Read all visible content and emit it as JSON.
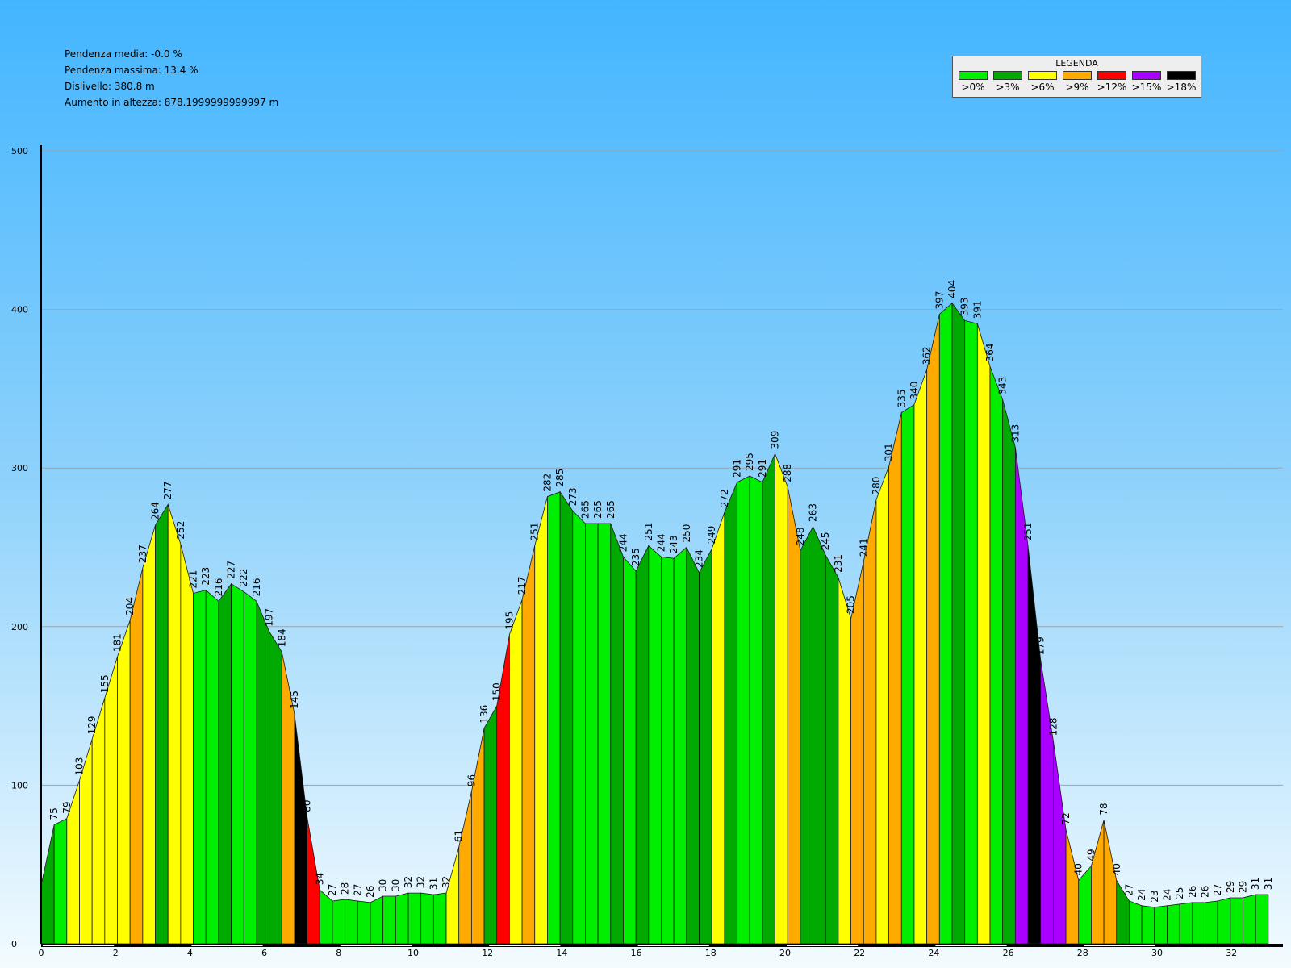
{
  "stats": {
    "avg_slope": "Pendenza media: -0.0 %",
    "max_slope": "Pendenza massima: 13.4 %",
    "drop": "Dislivello: 380.8 m",
    "gain": "Aumento in altezza: 878.1999999999997 m"
  },
  "legend": {
    "title": "LEGENDA",
    "items": [
      {
        "label": ">0%",
        "color": "#00ee00"
      },
      {
        "label": ">3%",
        "color": "#00aa00"
      },
      {
        "label": ">6%",
        "color": "#ffff00"
      },
      {
        "label": ">9%",
        "color": "#ffaa00"
      },
      {
        "label": ">12%",
        "color": "#ff0000"
      },
      {
        "label": ">15%",
        "color": "#aa00ff"
      },
      {
        "label": ">18%",
        "color": "#000000"
      }
    ]
  },
  "chart_data": {
    "type": "area",
    "ylim": [
      0,
      500
    ],
    "xlim": [
      0,
      33.5
    ],
    "yticks": [
      0,
      100,
      200,
      300,
      400,
      500
    ],
    "xticks": [
      0,
      2,
      4,
      6,
      8,
      10,
      12,
      14,
      16,
      18,
      20,
      22,
      24,
      26,
      28,
      30,
      32
    ],
    "grid": true,
    "legend_position": "top-right",
    "start_elevation": 37,
    "points": [
      [
        0.35,
        75,
        ">3%"
      ],
      [
        0.69,
        79,
        ">0%"
      ],
      [
        1.03,
        103,
        ">6%"
      ],
      [
        1.37,
        129,
        ">6%"
      ],
      [
        1.71,
        155,
        ">6%"
      ],
      [
        2.05,
        181,
        ">6%"
      ],
      [
        2.39,
        204,
        ">6%"
      ],
      [
        2.73,
        237,
        ">9%"
      ],
      [
        3.07,
        264,
        ">6%"
      ],
      [
        3.41,
        277,
        ">3%"
      ],
      [
        3.75,
        252,
        ">6%"
      ],
      [
        4.09,
        221,
        ">6%"
      ],
      [
        4.43,
        223,
        ">0%"
      ],
      [
        4.77,
        216,
        ">0%"
      ],
      [
        5.11,
        227,
        ">3%"
      ],
      [
        5.45,
        222,
        ">0%"
      ],
      [
        5.79,
        216,
        ">0%"
      ],
      [
        6.13,
        197,
        ">3%"
      ],
      [
        6.47,
        184,
        ">3%"
      ],
      [
        6.81,
        145,
        ">9%"
      ],
      [
        7.15,
        80,
        ">18%"
      ],
      [
        7.49,
        34,
        ">12%"
      ],
      [
        7.83,
        27,
        ">0%"
      ],
      [
        8.17,
        28,
        ">0%"
      ],
      [
        8.51,
        27,
        ">0%"
      ],
      [
        8.85,
        26,
        ">0%"
      ],
      [
        9.19,
        30,
        ">0%"
      ],
      [
        9.53,
        30,
        ">0%"
      ],
      [
        9.87,
        32,
        ">0%"
      ],
      [
        10.21,
        32,
        ">0%"
      ],
      [
        10.55,
        31,
        ">0%"
      ],
      [
        10.89,
        32,
        ">0%"
      ],
      [
        11.23,
        61,
        ">6%"
      ],
      [
        11.57,
        96,
        ">9%"
      ],
      [
        11.91,
        136,
        ">9%"
      ],
      [
        12.25,
        150,
        ">3%"
      ],
      [
        12.59,
        195,
        ">12%"
      ],
      [
        12.93,
        217,
        ">6%"
      ],
      [
        13.27,
        251,
        ">9%"
      ],
      [
        13.61,
        282,
        ">6%"
      ],
      [
        13.95,
        285,
        ">0%"
      ],
      [
        14.29,
        273,
        ">3%"
      ],
      [
        14.63,
        265,
        ">0%"
      ],
      [
        14.97,
        265,
        ">0%"
      ],
      [
        15.31,
        265,
        ">0%"
      ],
      [
        15.65,
        244,
        ">3%"
      ],
      [
        15.99,
        235,
        ">0%"
      ],
      [
        16.33,
        251,
        ">3%"
      ],
      [
        16.67,
        244,
        ">0%"
      ],
      [
        17.01,
        243,
        ">0%"
      ],
      [
        17.35,
        250,
        ">0%"
      ],
      [
        17.69,
        234,
        ">3%"
      ],
      [
        18.03,
        249,
        ">3%"
      ],
      [
        18.37,
        272,
        ">6%"
      ],
      [
        18.71,
        291,
        ">3%"
      ],
      [
        19.05,
        295,
        ">0%"
      ],
      [
        19.39,
        291,
        ">0%"
      ],
      [
        19.73,
        309,
        ">3%"
      ],
      [
        20.07,
        288,
        ">6%"
      ],
      [
        20.41,
        248,
        ">9%"
      ],
      [
        20.75,
        263,
        ">3%"
      ],
      [
        21.09,
        245,
        ">3%"
      ],
      [
        21.43,
        231,
        ">3%"
      ],
      [
        21.77,
        205,
        ">6%"
      ],
      [
        22.11,
        241,
        ">9%"
      ],
      [
        22.45,
        280,
        ">9%"
      ],
      [
        22.79,
        301,
        ">6%"
      ],
      [
        23.13,
        335,
        ">9%"
      ],
      [
        23.47,
        340,
        ">0%"
      ],
      [
        23.81,
        362,
        ">6%"
      ],
      [
        24.15,
        397,
        ">9%"
      ],
      [
        24.49,
        404,
        ">0%"
      ],
      [
        24.83,
        393,
        ">3%"
      ],
      [
        25.17,
        391,
        ">0%"
      ],
      [
        25.51,
        364,
        ">6%"
      ],
      [
        25.85,
        343,
        ">0%"
      ],
      [
        26.19,
        313,
        ">3%"
      ],
      [
        26.53,
        251,
        ">15%"
      ],
      [
        26.87,
        179,
        ">18%"
      ],
      [
        27.21,
        128,
        ">15%"
      ],
      [
        27.55,
        72,
        ">15%"
      ],
      [
        27.89,
        40,
        ">9%"
      ],
      [
        28.23,
        49,
        ">0%"
      ],
      [
        28.57,
        78,
        ">9%"
      ],
      [
        28.91,
        40,
        ">9%"
      ],
      [
        29.25,
        27,
        ">3%"
      ],
      [
        29.59,
        24,
        ">0%"
      ],
      [
        29.93,
        23,
        ">0%"
      ],
      [
        30.27,
        24,
        ">0%"
      ],
      [
        30.61,
        25,
        ">0%"
      ],
      [
        30.95,
        26,
        ">0%"
      ],
      [
        31.29,
        26,
        ">0%"
      ],
      [
        31.63,
        27,
        ">0%"
      ],
      [
        31.97,
        29,
        ">0%"
      ],
      [
        32.31,
        29,
        ">0%"
      ],
      [
        32.65,
        31,
        ">0%"
      ],
      [
        32.99,
        31,
        ">0%"
      ]
    ]
  }
}
